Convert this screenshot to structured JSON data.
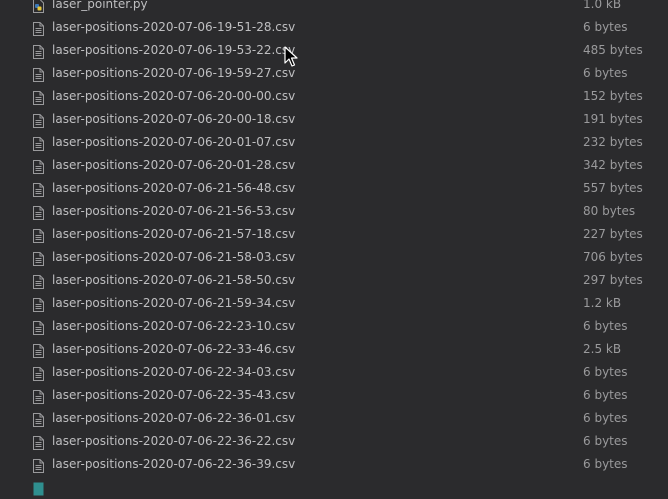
{
  "files": [
    {
      "name": "laser_pointer.py",
      "size": "1.0 kB",
      "icon": "python-file-icon"
    },
    {
      "name": "laser-positions-2020-07-06-19-51-28.csv",
      "size": "6 bytes",
      "icon": "document-icon"
    },
    {
      "name": "laser-positions-2020-07-06-19-53-22.csv",
      "size": "485 bytes",
      "icon": "document-icon"
    },
    {
      "name": "laser-positions-2020-07-06-19-59-27.csv",
      "size": "6 bytes",
      "icon": "document-icon"
    },
    {
      "name": "laser-positions-2020-07-06-20-00-00.csv",
      "size": "152 bytes",
      "icon": "document-icon"
    },
    {
      "name": "laser-positions-2020-07-06-20-00-18.csv",
      "size": "191 bytes",
      "icon": "document-icon"
    },
    {
      "name": "laser-positions-2020-07-06-20-01-07.csv",
      "size": "232 bytes",
      "icon": "document-icon"
    },
    {
      "name": "laser-positions-2020-07-06-20-01-28.csv",
      "size": "342 bytes",
      "icon": "document-icon"
    },
    {
      "name": "laser-positions-2020-07-06-21-56-48.csv",
      "size": "557 bytes",
      "icon": "document-icon"
    },
    {
      "name": "laser-positions-2020-07-06-21-56-53.csv",
      "size": "80 bytes",
      "icon": "document-icon"
    },
    {
      "name": "laser-positions-2020-07-06-21-57-18.csv",
      "size": "227 bytes",
      "icon": "document-icon"
    },
    {
      "name": "laser-positions-2020-07-06-21-58-03.csv",
      "size": "706 bytes",
      "icon": "document-icon"
    },
    {
      "name": "laser-positions-2020-07-06-21-58-50.csv",
      "size": "297 bytes",
      "icon": "document-icon"
    },
    {
      "name": "laser-positions-2020-07-06-21-59-34.csv",
      "size": "1.2 kB",
      "icon": "document-icon"
    },
    {
      "name": "laser-positions-2020-07-06-22-23-10.csv",
      "size": "6 bytes",
      "icon": "document-icon"
    },
    {
      "name": "laser-positions-2020-07-06-22-33-46.csv",
      "size": "2.5 kB",
      "icon": "document-icon"
    },
    {
      "name": "laser-positions-2020-07-06-22-34-03.csv",
      "size": "6 bytes",
      "icon": "document-icon"
    },
    {
      "name": "laser-positions-2020-07-06-22-35-43.csv",
      "size": "6 bytes",
      "icon": "document-icon"
    },
    {
      "name": "laser-positions-2020-07-06-22-36-01.csv",
      "size": "6 bytes",
      "icon": "document-icon"
    },
    {
      "name": "laser-positions-2020-07-06-22-36-22.csv",
      "size": "6 bytes",
      "icon": "document-icon"
    },
    {
      "name": "laser-positions-2020-07-06-22-36-39.csv",
      "size": "6 bytes",
      "icon": "document-icon"
    },
    {
      "name": "",
      "size": "",
      "icon": "generic-file-icon"
    }
  ],
  "colors": {
    "background": "#2b2b2d",
    "text": "#bfbfc1",
    "size_text": "#9a9a9c",
    "icon": "#9a9a9c"
  }
}
